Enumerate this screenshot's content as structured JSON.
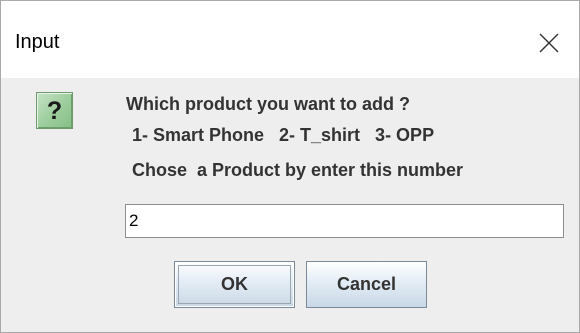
{
  "window": {
    "title": "Input",
    "close_symbol": "×"
  },
  "dialog": {
    "icon": "question-icon",
    "icon_glyph": "?",
    "icon_color": "#9ccd9c",
    "message_lines": [
      "Which product you want to add ?",
      "1- Smart Phone   2- T_shirt   3- OPP",
      "Chose  a Product by enter this number"
    ],
    "input_value": "2"
  },
  "buttons": {
    "ok_label": "OK",
    "cancel_label": "Cancel"
  }
}
